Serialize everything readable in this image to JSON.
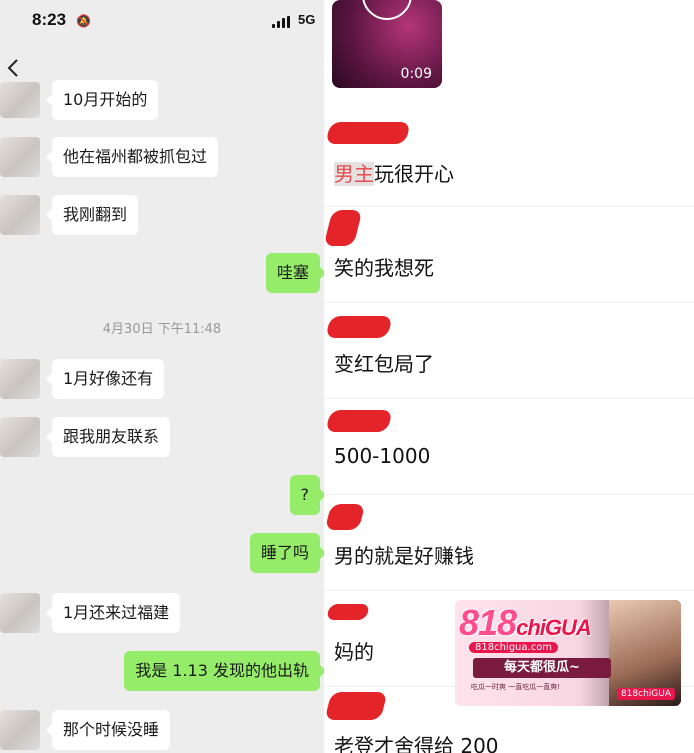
{
  "status_bar": {
    "time": "8:23",
    "network": "5G"
  },
  "chat": {
    "messages": [
      {
        "side": "in",
        "text": "10月开始的"
      },
      {
        "side": "in",
        "text": "他在福州都被抓包过"
      },
      {
        "side": "in",
        "text": "我刚翻到"
      },
      {
        "side": "out",
        "text": "哇塞"
      },
      {
        "side": "in",
        "text": "1月好像还有"
      },
      {
        "side": "in",
        "text": "跟我朋友联系"
      },
      {
        "side": "out",
        "text": "?"
      },
      {
        "side": "out",
        "text": "睡了吗"
      },
      {
        "side": "in",
        "text": "1月还来过福建"
      },
      {
        "side": "out",
        "text": "我是 1.13 发现的他出轨"
      },
      {
        "side": "in",
        "text": "那个时候没睡"
      }
    ],
    "timestamp": "4月30日 下午11:48"
  },
  "comments": {
    "video_duration": "0:09",
    "items": [
      {
        "highlight": "男主",
        "text": "玩很开心"
      },
      {
        "highlight": "",
        "text": "笑的我想死"
      },
      {
        "highlight": "",
        "text": "变红包局了"
      },
      {
        "highlight": "",
        "text": "500-1000"
      },
      {
        "highlight": "",
        "text": "男的就是好赚钱"
      },
      {
        "highlight": "",
        "text": "妈的"
      },
      {
        "highlight": "",
        "text": "老登才舍得给 200"
      }
    ]
  },
  "watermark": {
    "logo": "818",
    "logo_suffix": "chiGUA",
    "url": "818chigua.com",
    "slogan": "每天都很瓜~",
    "subline": "吃瓜一时爽 一直吃瓜一直爽!",
    "brand": "818chiGUA"
  }
}
